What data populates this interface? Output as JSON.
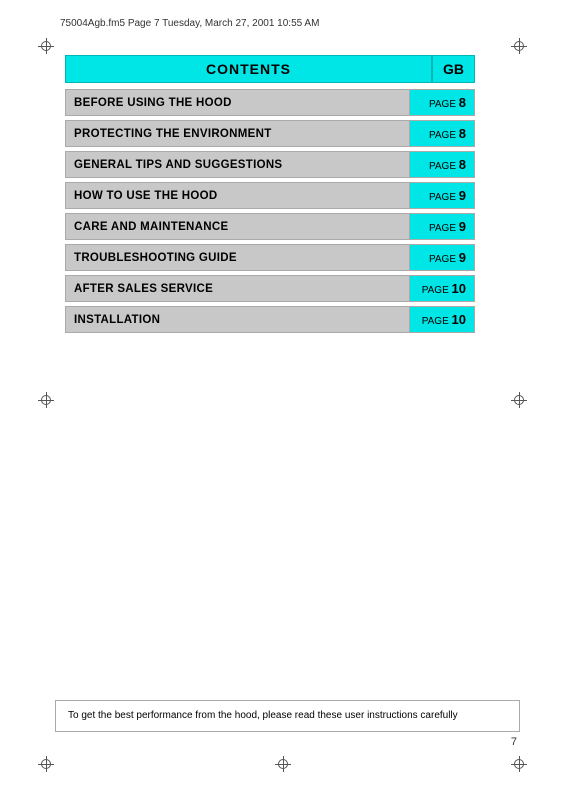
{
  "file_info": {
    "text": "75004Agb.fm5  Page 7  Tuesday, March 27, 2001  10:55 AM"
  },
  "contents_header": {
    "title": "CONTENTS",
    "gb_label": "GB"
  },
  "toc_items": [
    {
      "label": "BEFORE USING THE HOOD",
      "page_word": "PAGE",
      "page_num": "8"
    },
    {
      "label": "PROTECTING THE ENVIRONMENT",
      "page_word": "PAGE",
      "page_num": "8"
    },
    {
      "label": "GENERAL TIPS AND SUGGESTIONS",
      "page_word": "PAGE",
      "page_num": "8"
    },
    {
      "label": "HOW TO USE THE HOOD",
      "page_word": "PAGE",
      "page_num": "9"
    },
    {
      "label": "CARE AND MAINTENANCE",
      "page_word": "PAGE",
      "page_num": "9"
    },
    {
      "label": "TROUBLESHOOTING GUIDE",
      "page_word": "PAGE",
      "page_num": "9"
    },
    {
      "label": "AFTER SALES SERVICE",
      "page_word": "PAGE",
      "page_num": "10"
    },
    {
      "label": "INSTALLATION",
      "page_word": "PAGE",
      "page_num": "10"
    }
  ],
  "bottom_note": {
    "text": "To get the best performance from the hood, please read these user instructions carefully"
  },
  "page_number": "7"
}
